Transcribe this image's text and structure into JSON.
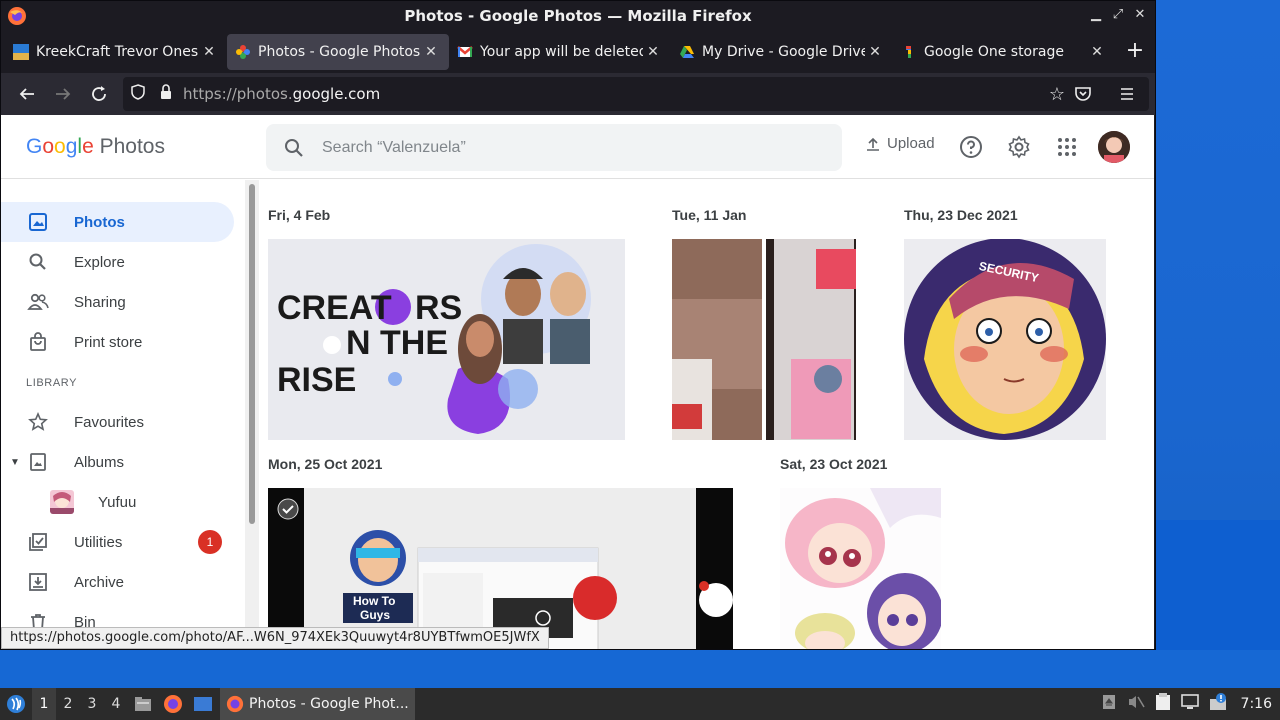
{
  "window": {
    "title": "Photos - Google Photos — Mozilla Firefox"
  },
  "tabs": [
    {
      "label": "KreekCraft Trevor Onesie",
      "icon": "youtube-thumb-icon",
      "active": false
    },
    {
      "label": "Photos - Google Photos",
      "icon": "google-photos-icon",
      "active": true
    },
    {
      "label": "Your app will be deleted",
      "icon": "gmail-icon",
      "active": false
    },
    {
      "label": "My Drive - Google Drive",
      "icon": "google-drive-icon",
      "active": false
    },
    {
      "label": "Google One storage",
      "icon": "google-one-icon",
      "active": false
    }
  ],
  "navbar": {
    "url_prefix": "https://photos.",
    "url_domain": "google.com"
  },
  "header": {
    "logo_google": "Google",
    "logo_photos": "Photos",
    "search_placeholder": "Search “Valenzuela”",
    "upload_label": "Upload"
  },
  "sidebar": {
    "items": [
      {
        "label": "Photos",
        "icon": "photos-icon",
        "active": true
      },
      {
        "label": "Explore",
        "icon": "search-icon"
      },
      {
        "label": "Sharing",
        "icon": "people-icon"
      },
      {
        "label": "Print store",
        "icon": "shopping-bag-icon"
      }
    ],
    "library_heading": "LIBRARY",
    "library": [
      {
        "label": "Favourites",
        "icon": "star-icon"
      },
      {
        "label": "Albums",
        "icon": "album-icon"
      },
      {
        "label": "Yufuu",
        "icon": "album-thumb"
      },
      {
        "label": "Utilities",
        "icon": "utilities-icon",
        "badge": "1"
      },
      {
        "label": "Archive",
        "icon": "archive-icon"
      },
      {
        "label": "Bin",
        "icon": "trash-icon"
      }
    ]
  },
  "timeline": {
    "groups": [
      {
        "date": "Fri, 4 Feb"
      },
      {
        "date": "Tue, 11 Jan"
      },
      {
        "date": "Thu, 23 Dec 2021"
      },
      {
        "date": "Mon, 25 Oct 2021"
      },
      {
        "date": "Sat, 23 Oct 2021"
      }
    ],
    "creators_text": [
      "CREAT",
      "RS",
      "N THE",
      "RISE"
    ],
    "security_cap": "SECURITY",
    "howto_text": [
      "How To",
      "Guys"
    ]
  },
  "status_url": "https://photos.google.com/photo/AF...W6N_974XEk3Quuwyt4r8UYBTfwmOE5JWfX",
  "taskbar": {
    "workspaces": [
      "1",
      "2",
      "3",
      "4"
    ],
    "app_label": "Photos - Google Phot...",
    "clock": "7:16"
  },
  "colors": {
    "accent": "#1967d2",
    "active_bg": "#e8f0fe",
    "badge": "#d93025"
  }
}
